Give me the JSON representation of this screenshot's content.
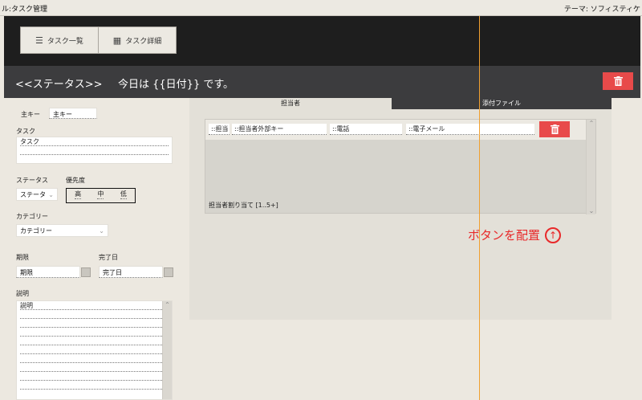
{
  "window": {
    "title_left": "ル:タスク管理",
    "title_right": "テーマ: ソフィスティケ"
  },
  "nav": {
    "task_list": "タスク一覧",
    "task_detail": "タスク詳細"
  },
  "header": {
    "status": "<<ステータス>>",
    "today": "今日は {{日付}} です。"
  },
  "form": {
    "primary_key_label": "主キー",
    "primary_key_value": "主キー",
    "task_label": "タスク",
    "task_value": "タスク",
    "status_label": "ステータス",
    "status_value": "ステータ",
    "priority_label": "優先度",
    "priority_high": "高",
    "priority_mid": "中",
    "priority_low": "低",
    "category_label": "カテゴリー",
    "category_value": "カテゴリー",
    "due_label": "期限",
    "due_value": "期限",
    "done_label": "完了日",
    "done_value": "完了日",
    "description_label": "説明",
    "description_value": "説明"
  },
  "panel": {
    "tab_assignee": "担当者",
    "tab_attachment": "添付ファイル",
    "cell_assignee": "::担当",
    "cell_external_key": "::担当者外部キー",
    "cell_phone": "::電話",
    "cell_email": "::電子メール",
    "portal_label": "担当者割り当て [1..5+]"
  },
  "annotation": {
    "text": "ボタンを配置"
  },
  "colors": {
    "accent_red": "#e84a4a",
    "dark_bar": "#3c3c3e",
    "guide_orange": "#f0a030"
  }
}
